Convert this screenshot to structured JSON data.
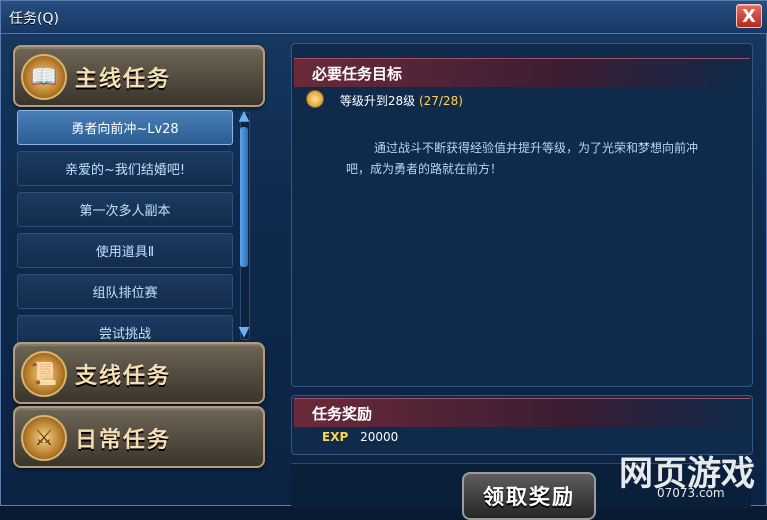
{
  "window": {
    "title": "任务(Q)",
    "close_glyph": "X"
  },
  "left": {
    "categories": [
      {
        "label": "主线任务",
        "icon": "book-icon"
      },
      {
        "label": "支线任务",
        "icon": "scroll-icon"
      },
      {
        "label": "日常任务",
        "icon": "sword-icon"
      }
    ],
    "tasks": [
      {
        "label": "勇者向前冲~Lv28",
        "active": true
      },
      {
        "label": "亲爱的~我们结婚吧!"
      },
      {
        "label": "第一次多人副本"
      },
      {
        "label": "使用道具Ⅱ"
      },
      {
        "label": "组队排位赛"
      },
      {
        "label": "尝试挑战"
      }
    ],
    "scroll_up_glyph": "▲",
    "scroll_down_glyph": "▼"
  },
  "objective": {
    "heading": "必要任务目标",
    "goal": "等级升到28级",
    "progress": "(27/28)",
    "description": "通过战斗不断获得经验值并提升等级，为了光荣和梦想向前冲吧，成为勇者的路就在前方！"
  },
  "reward": {
    "heading": "任务奖励",
    "type": "EXP",
    "amount": "20000"
  },
  "action": {
    "claim_label": "领取奖励"
  },
  "watermark": {
    "main": "网页游戏",
    "sub": "07073.com"
  }
}
